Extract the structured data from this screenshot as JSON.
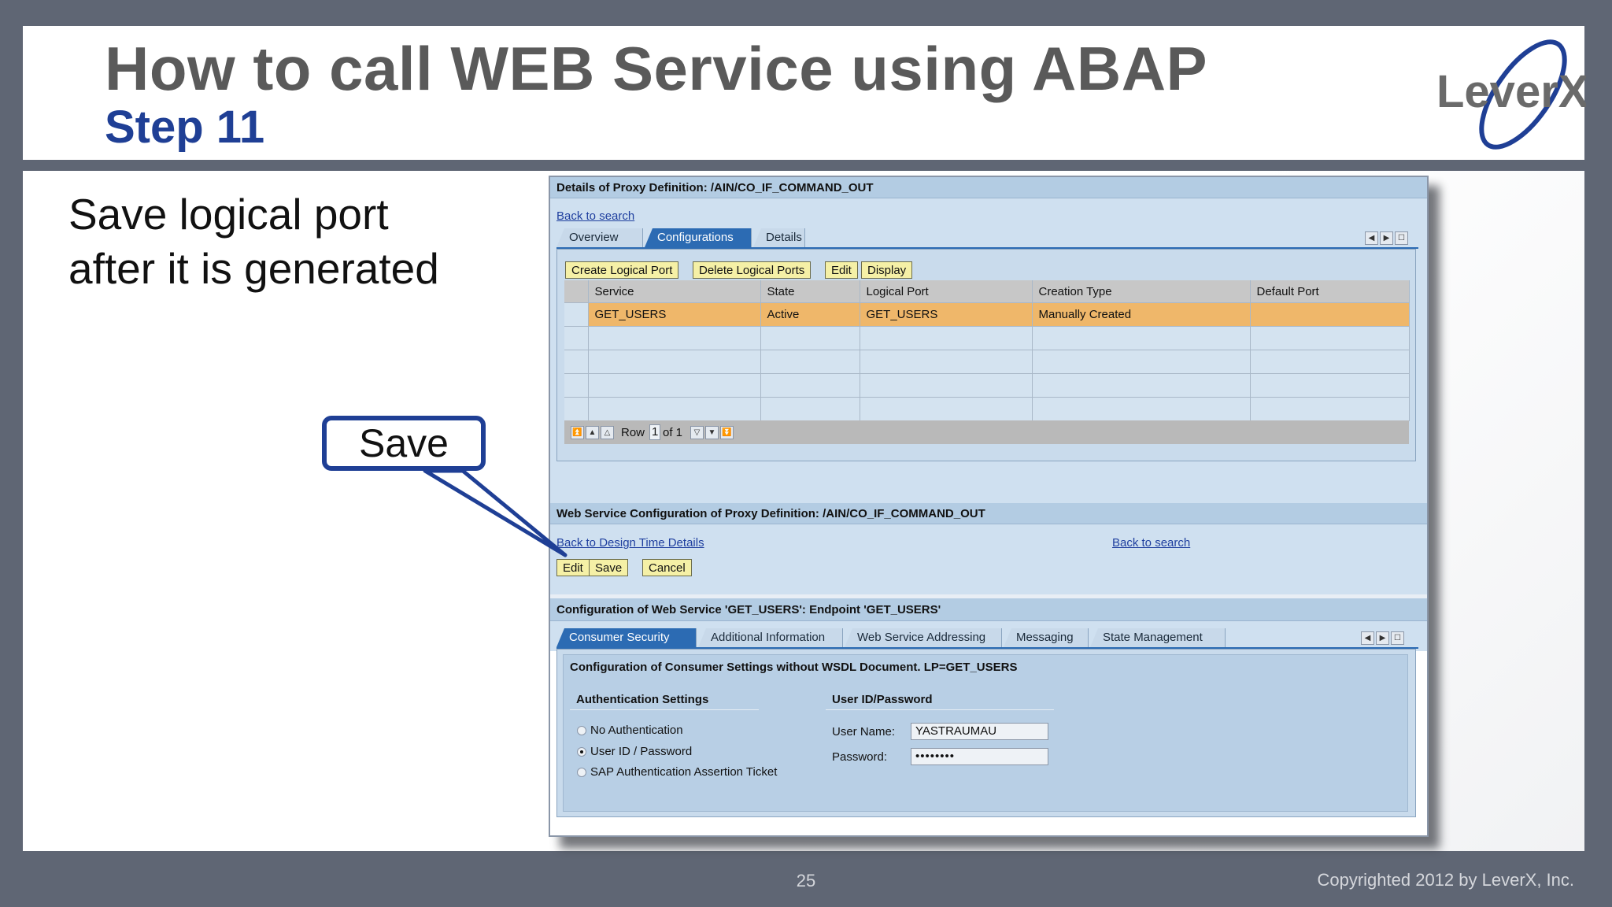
{
  "slide": {
    "title": "How to call WEB Service using ABAP",
    "subtitle": "Step 11",
    "body_text": "Save logical port after it is generated",
    "callout_label": "Save",
    "page_number": "25",
    "copyright": "Copyrighted 2012 by LeverX, Inc.",
    "logo_text": "LeverX"
  },
  "proxy_details": {
    "header": "Details of Proxy Definition: /AIN/CO_IF_COMMAND_OUT",
    "back_link": "Back to search",
    "tabs": [
      {
        "label": "Overview",
        "active": false
      },
      {
        "label": "Configurations",
        "active": true
      },
      {
        "label": "Details",
        "active": false
      }
    ],
    "toolbar": {
      "create": "Create Logical Port",
      "delete": "Delete Logical Ports",
      "edit": "Edit",
      "display": "Display"
    },
    "table": {
      "columns": [
        "Service",
        "State",
        "Logical Port",
        "Creation Type",
        "Default Port"
      ],
      "rows": [
        [
          "GET_USERS",
          "Active",
          "GET_USERS",
          "Manually Created",
          ""
        ]
      ]
    },
    "pager": {
      "row_label": "Row",
      "row_value": "1",
      "of_label": "of 1"
    }
  },
  "ws_config": {
    "header": "Web Service Configuration of Proxy Definition: /AIN/CO_IF_COMMAND_OUT",
    "back_design_link": "Back to Design Time Details",
    "back_search_link": "Back to search",
    "buttons": {
      "edit": "Edit",
      "save": "Save",
      "cancel": "Cancel"
    }
  },
  "endpoint_config": {
    "header": "Configuration of Web Service 'GET_USERS': Endpoint 'GET_USERS'",
    "tabs": [
      {
        "label": "Consumer Security",
        "active": true
      },
      {
        "label": "Additional Information",
        "active": false
      },
      {
        "label": "Web Service Addressing",
        "active": false
      },
      {
        "label": "Messaging",
        "active": false
      },
      {
        "label": "State Management",
        "active": false
      }
    ],
    "group_title": "Configuration of Consumer Settings without WSDL Document. LP=GET_USERS",
    "auth_settings_label": "Authentication Settings",
    "auth_options": [
      {
        "label": "No Authentication",
        "selected": false
      },
      {
        "label": "User ID / Password",
        "selected": true
      },
      {
        "label": "SAP Authentication Assertion Ticket",
        "selected": false
      }
    ],
    "userid_section_label": "User ID/Password",
    "user_name_label": "User Name:",
    "user_name_value": "YASTRAUMAU",
    "password_label": "Password:",
    "password_value": "••••••••"
  },
  "colors": {
    "title_gray": "#5a5a5a",
    "subtitle_blue": "#1f3f95",
    "slide_background": "#5f6674",
    "selected_row": "#efb76a",
    "sap_band": "#b3cce3",
    "button_yellow": "#f5f0a6",
    "active_tab": "#2c6bb3"
  }
}
